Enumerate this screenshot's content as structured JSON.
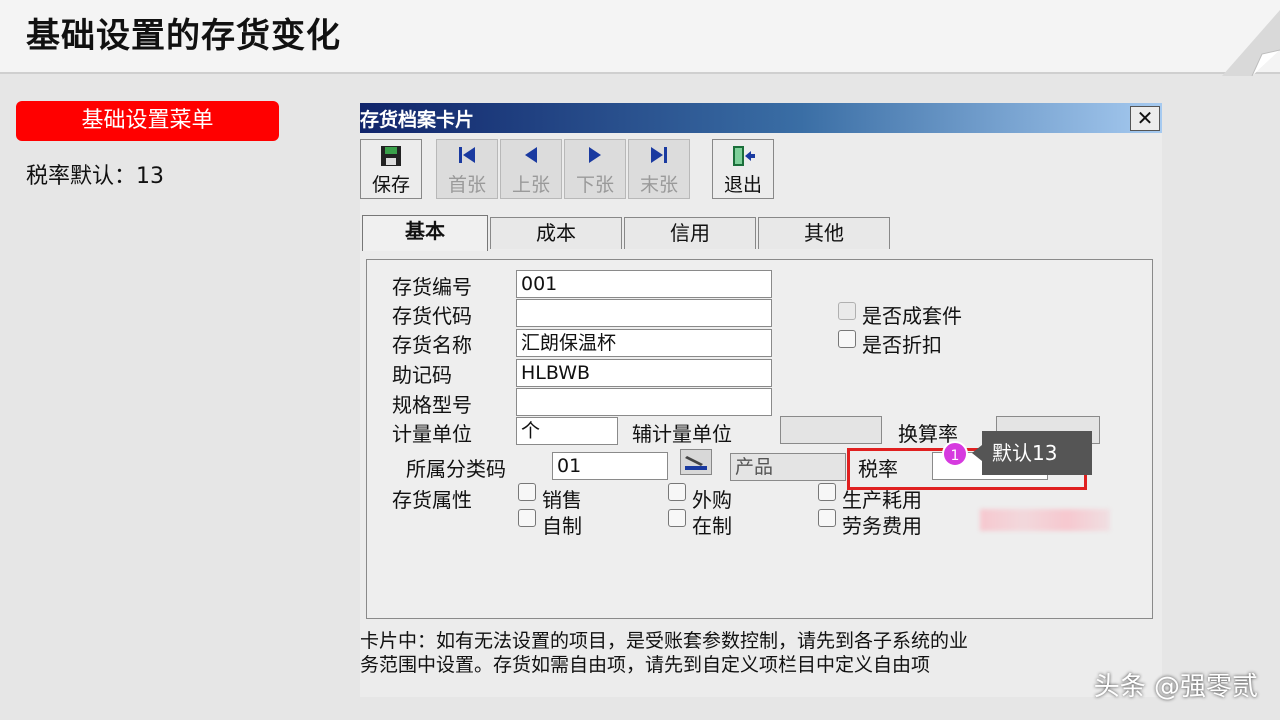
{
  "slide": {
    "title": "基础设置的存货变化",
    "menu_badge": "基础设置菜单",
    "tax_default_text": "税率默认：13"
  },
  "dialog": {
    "title": "存货档案卡片",
    "close": "✕",
    "toolbar": [
      {
        "label": "保存",
        "icon": "save-icon",
        "state": "active"
      },
      {
        "label": "首张",
        "icon": "first-icon",
        "state": "disabled"
      },
      {
        "label": "上张",
        "icon": "prev-icon",
        "state": "disabled"
      },
      {
        "label": "下张",
        "icon": "next-icon",
        "state": "disabled"
      },
      {
        "label": "末张",
        "icon": "last-icon",
        "state": "disabled"
      },
      {
        "label": "退出",
        "icon": "exit-icon",
        "state": "active"
      }
    ],
    "tabs": [
      {
        "label": "基本",
        "active": true
      },
      {
        "label": "成本",
        "active": false
      },
      {
        "label": "信用",
        "active": false
      },
      {
        "label": "其他",
        "active": false
      }
    ],
    "fields": {
      "code_label": "存货编号",
      "code_value": "001",
      "alias_label": "存货代码",
      "alias_value": "",
      "name_label": "存货名称",
      "name_value": "汇朗保温杯",
      "mnemonic_label": "助记码",
      "mnemonic_value": "HLBWB",
      "spec_label": "规格型号",
      "spec_value": "",
      "unit_label": "计量单位",
      "unit_value": "个",
      "aux_unit_label": "辅计量单位",
      "aux_unit_value": "",
      "conversion_label": "换算率",
      "conversion_value": "",
      "category_label": "所属分类码",
      "category_value": "01",
      "category_name": "产品",
      "tax_label": "税率",
      "tax_value": "",
      "attr_label": "存货属性"
    },
    "checks": {
      "is_kit": "是否成套件",
      "is_discount": "是否折扣",
      "sales": "销售",
      "purchase": "外购",
      "production": "生产耗用",
      "self_made": "自制",
      "in_process": "在制",
      "labor": "劳务费用"
    },
    "annotation": {
      "marker": "1",
      "callout": "默认13"
    },
    "note_line1": "卡片中：如有无法设置的项目，是受账套参数控制，请先到各子系统的业",
    "note_line2": "务范围中设置。存货如需自由项，请先到自定义项栏目中定义自由项"
  },
  "watermark": "头条 @强零贰"
}
